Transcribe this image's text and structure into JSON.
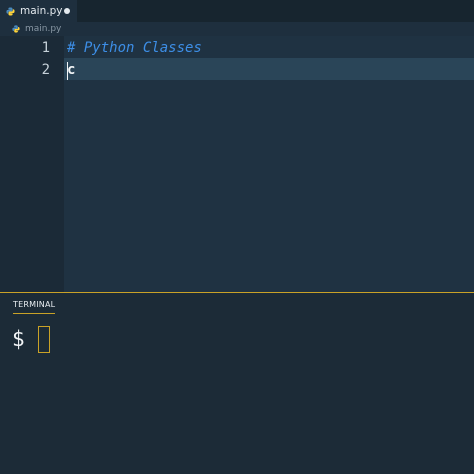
{
  "tab": {
    "filename": "main.py",
    "icon": "python-icon",
    "modified": true
  },
  "breadcrumb": {
    "filename": "main.py",
    "icon": "python-icon"
  },
  "editor": {
    "line_numbers": [
      "1",
      "2"
    ],
    "lines": [
      "# Python Classes",
      "c"
    ],
    "current_line": 2
  },
  "terminal": {
    "tab_label": "TERMINAL",
    "prompt": "$"
  },
  "colors": {
    "comment": "#3d8ee6",
    "accent": "#c9a227",
    "editor_bg": "#1f3242",
    "current_line_bg": "#2a4558"
  }
}
